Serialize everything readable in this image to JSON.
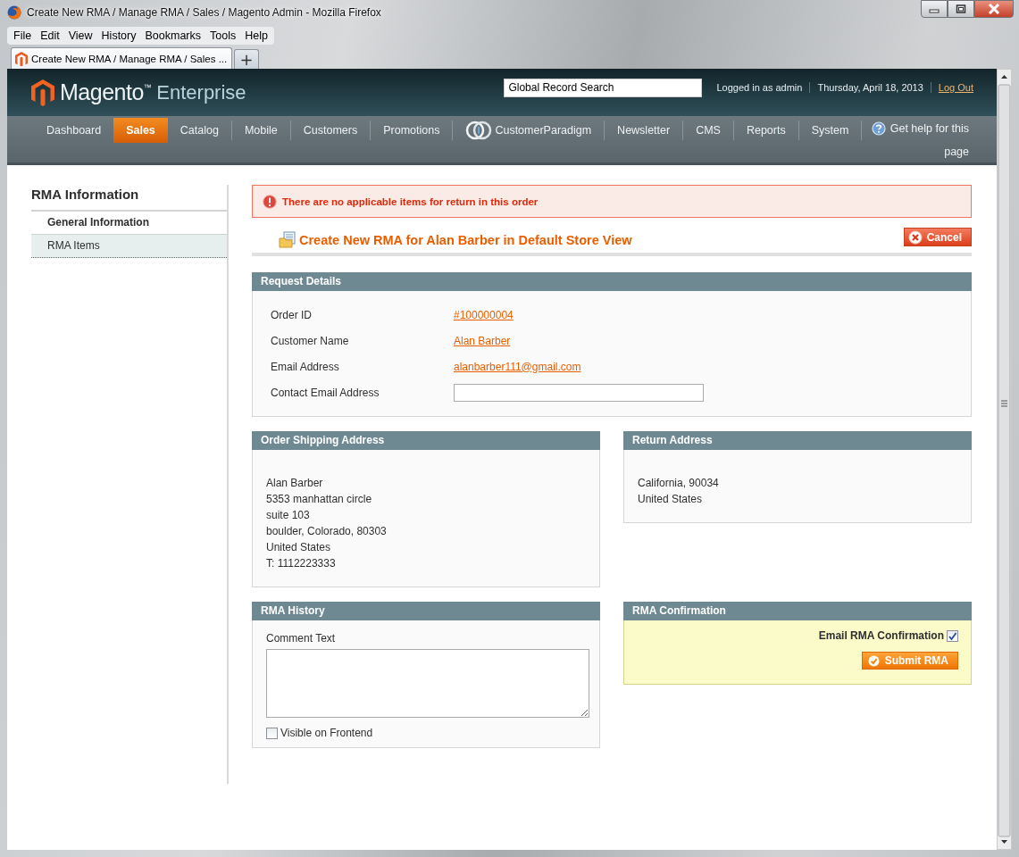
{
  "window": {
    "title": "Create New RMA / Manage RMA / Sales / Magento Admin - Mozilla Firefox"
  },
  "menu": [
    "File",
    "Edit",
    "View",
    "History",
    "Bookmarks",
    "Tools",
    "Help"
  ],
  "browser_tabs": [
    {
      "label": "Create New RMA / Manage RMA / Sales ...",
      "selected": true
    }
  ],
  "new_tab": "+",
  "header": {
    "logo": "Magento$^{™}$",
    "edition": "Enterprise",
    "search": {
      "value": "Global Record Search"
    },
    "user": "Logged in as admin",
    "date": "Thursday, April 18, 2013",
    "logout": "Log Out"
  },
  "nav": [
    {
      "label": "Dashboard",
      "selected": false,
      "kind": "text"
    },
    {
      "label": "Sales",
      "selected": true,
      "kind": "text"
    },
    {
      "label": "Catalog",
      "selected": false,
      "kind": "text"
    },
    {
      "label": "Mobile",
      "selected": false,
      "kind": "text"
    },
    {
      "label": "Customers",
      "selected": false,
      "kind": "text"
    },
    {
      "label": "Promotions",
      "selected": false,
      "kind": "text"
    },
    {
      "label": "CustomerParadigm",
      "selected": false,
      "kind": "logo"
    },
    {
      "label": "Newsletter",
      "selected": false,
      "kind": "text"
    },
    {
      "label": "CMS",
      "selected": false,
      "kind": "text"
    },
    {
      "label": "Reports",
      "selected": false,
      "kind": "text"
    },
    {
      "label": "System",
      "selected": false,
      "kind": "text"
    }
  ],
  "help": "Get help for this page",
  "sidebar": {
    "title": "RMA Information",
    "tabs": [
      {
        "label": "General Information",
        "selected": true
      },
      {
        "label": "RMA Items",
        "selected": false
      }
    ]
  },
  "message": "There are no applicable items for return in this order",
  "page_title": "Create New RMA for Alan Barber in Default Store View",
  "cancel_button": "Cancel",
  "request_details": {
    "title": "Request Details",
    "fields": [
      {
        "label": "Order ID",
        "kind": "link",
        "value": "#100000004"
      },
      {
        "label": "Customer Name",
        "kind": "link",
        "value": "Alan Barber"
      },
      {
        "label": "Email Address",
        "kind": "link",
        "value": "alanbarber111@gmail.com"
      },
      {
        "label": "Contact Email Address",
        "kind": "input"
      }
    ]
  },
  "shipping_address": {
    "title": "Order Shipping Address",
    "lines": [
      "Alan Barber",
      "5353 manhattan circle",
      "suite 103",
      "boulder, Colorado, 80303",
      "United States",
      "T: 1112223333"
    ]
  },
  "return_address": {
    "title": "Return Address",
    "lines": [
      "California, 90034",
      "United States"
    ]
  },
  "history": {
    "title": "RMA History",
    "comment_label": "Comment Text",
    "visible_on_frontend": {
      "label": "Visible on Frontend",
      "checked": false
    }
  },
  "confirmation": {
    "title": "RMA Confirmation",
    "email_confirmation": {
      "label": "Email RMA Confirmation",
      "checked": true
    },
    "submit_button": "Submit RMA"
  }
}
